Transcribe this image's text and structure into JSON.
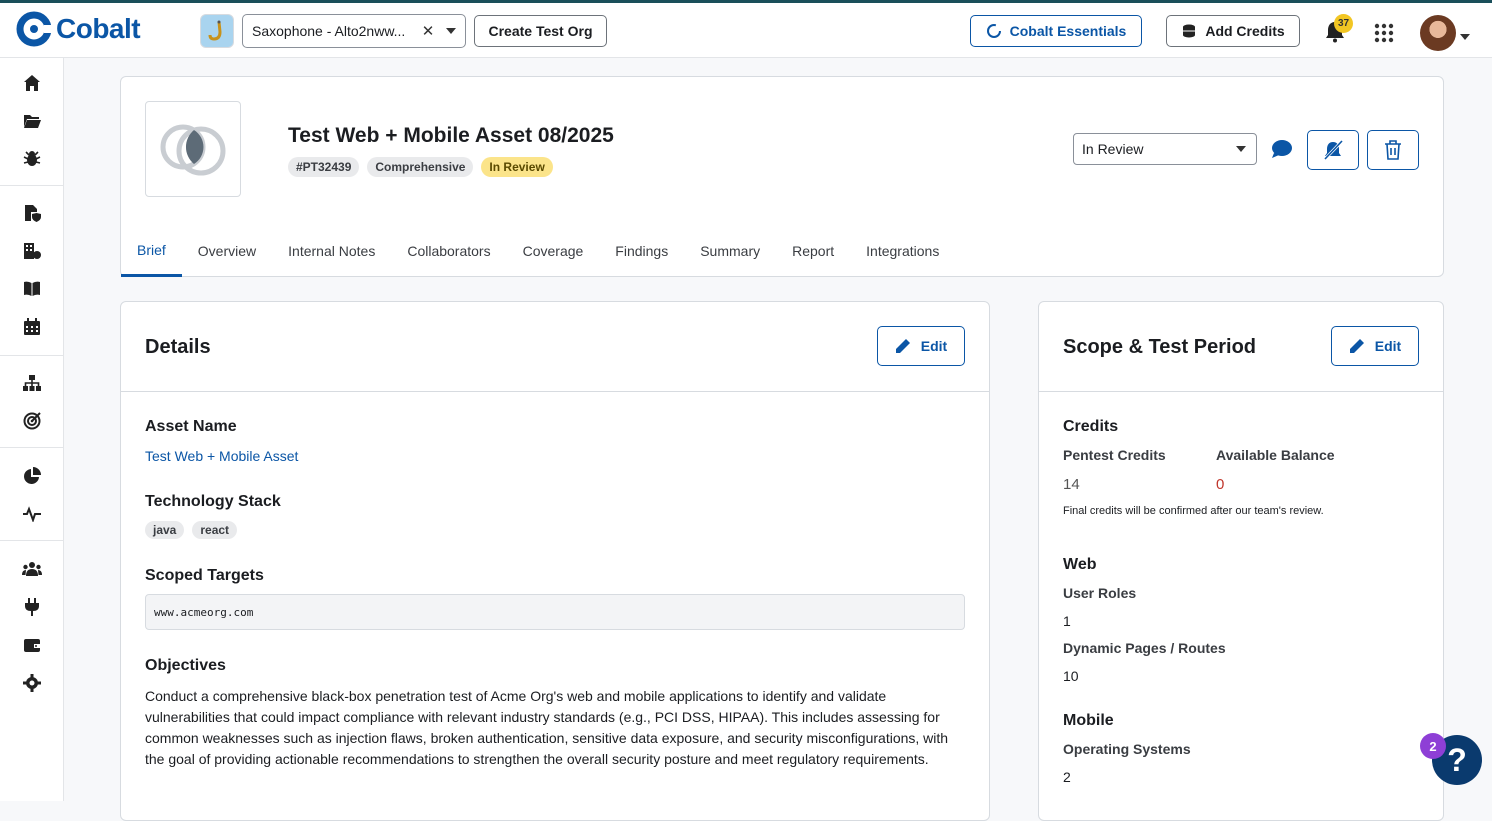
{
  "brand": {
    "name": "Cobalt",
    "color": "#0b56a6"
  },
  "topbar": {
    "org_value": "Saxophone - Alto2nww...",
    "create_org_label": "Create Test Org",
    "essentials_label": "Cobalt Essentials",
    "add_credits_label": "Add Credits",
    "notifications_count": "37"
  },
  "sidebar": {
    "icons": [
      "home-icon",
      "folder-icon",
      "bug-icon",
      "file-shield-icon",
      "building-icon",
      "book-icon",
      "calendar-icon",
      "sitemap-icon",
      "target-icon",
      "pie-chart-icon",
      "activity-icon",
      "users-icon",
      "plug-icon",
      "wallet-icon",
      "gear-icon"
    ]
  },
  "asset": {
    "title": "Test Web + Mobile Asset 08/2025",
    "tags": [
      "#PT32439",
      "Comprehensive",
      "In Review"
    ],
    "status_value": "In Review"
  },
  "tabs": [
    "Brief",
    "Overview",
    "Internal Notes",
    "Collaborators",
    "Coverage",
    "Findings",
    "Summary",
    "Report",
    "Integrations"
  ],
  "active_tab": "Brief",
  "details": {
    "title": "Details",
    "edit_label": "Edit",
    "asset_name_label": "Asset Name",
    "asset_name_value": "Test Web + Mobile Asset",
    "tech_stack_label": "Technology Stack",
    "tech_stack": [
      "java",
      "react"
    ],
    "scoped_targets_label": "Scoped Targets",
    "scoped_targets_value": "www.acmeorg.com",
    "objectives_label": "Objectives",
    "objectives_text": "Conduct a comprehensive black-box penetration test of Acme Org's web and mobile applications to identify and validate vulnerabilities that could impact compliance with relevant industry standards (e.g., PCI DSS, HIPAA). This includes assessing for common weaknesses such as injection flaws, broken authentication, sensitive data exposure, and security misconfigurations, with the goal of providing actionable recommendations to strengthen the overall security posture and meet regulatory requirements."
  },
  "scope": {
    "title": "Scope & Test Period",
    "edit_label": "Edit",
    "credits_label": "Credits",
    "pentest_credits_label": "Pentest Credits",
    "pentest_credits_value": "14",
    "available_balance_label": "Available Balance",
    "available_balance_value": "0",
    "credits_note": "Final credits will be confirmed after our team's review.",
    "web_label": "Web",
    "user_roles_label": "User Roles",
    "user_roles_value": "1",
    "dynamic_pages_label": "Dynamic Pages / Routes",
    "dynamic_pages_value": "10",
    "mobile_label": "Mobile",
    "os_label": "Operating Systems",
    "os_value": "2"
  },
  "help": {
    "badge_count": "2",
    "label": "?"
  }
}
